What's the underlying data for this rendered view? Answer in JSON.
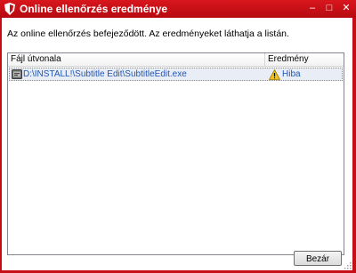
{
  "window": {
    "title": "Online ellenőrzés eredménye",
    "controls": {
      "minimize": "–",
      "maximize": "□",
      "close": "✕"
    }
  },
  "message": "Az online ellenőrzés befejeződött. Az eredményeket láthatja a listán.",
  "list": {
    "columns": {
      "path": "Fájl útvonala",
      "result": "Eredmény"
    },
    "rows": [
      {
        "path": "D:\\INSTALL!\\Subtitle Edit\\SubtitleEdit.exe",
        "result": "Hiba",
        "result_icon": "warning-icon"
      }
    ]
  },
  "buttons": {
    "close": "Bezár"
  },
  "colors": {
    "titlebar": "#c70d15",
    "link_text": "#1f56b4",
    "row_highlight": "#e8edf6"
  }
}
